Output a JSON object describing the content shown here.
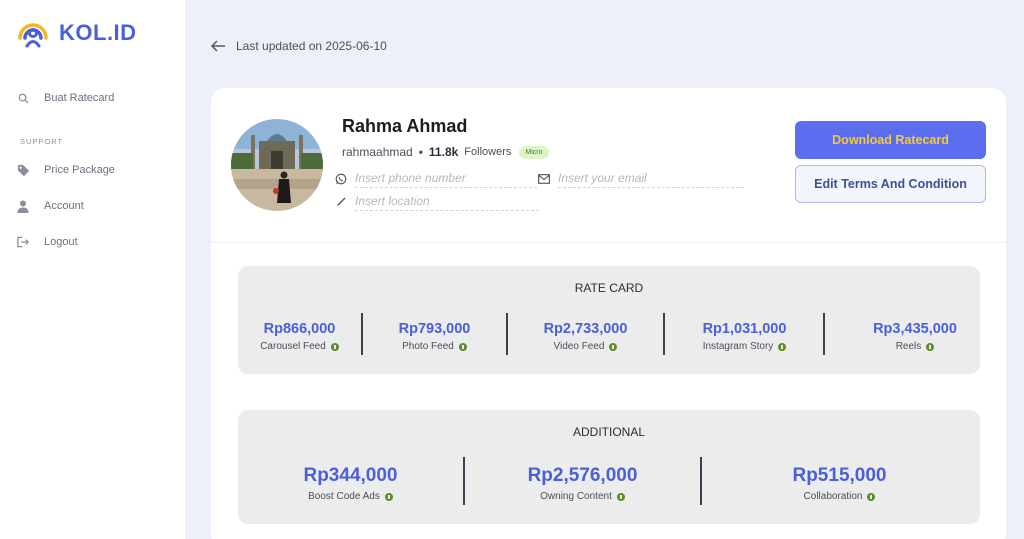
{
  "app": {
    "logo_text": "KOL.ID",
    "accent": "#4a5fd8"
  },
  "sidebar": {
    "items": [
      {
        "label": "Buat Ratecard",
        "icon": "search-icon"
      },
      {
        "label": "Price Package",
        "icon": "tag-icon"
      },
      {
        "label": "Account",
        "icon": "user-icon"
      },
      {
        "label": "Logout",
        "icon": "logout-icon"
      }
    ],
    "section_label": "SUPPORT"
  },
  "header": {
    "last_updated": "Last updated on 2025-06-10"
  },
  "profile": {
    "name": "Rahma Ahmad",
    "username": "rahmaahmad",
    "followers_count": "11.8k",
    "followers_label": "Followers",
    "tier_badge": "Micro",
    "phone_placeholder": "Insert phone number",
    "email_placeholder": "Insert your email",
    "location_placeholder": "Insert location"
  },
  "actions": {
    "download_label": "Download Ratecard",
    "edit_label": "Edit Terms And Condition"
  },
  "rate_card": {
    "title": "RATE CARD",
    "items": [
      {
        "price": "Rp866,000",
        "label": "Carousel Feed"
      },
      {
        "price": "Rp793,000",
        "label": "Photo Feed"
      },
      {
        "price": "Rp2,733,000",
        "label": "Video Feed"
      },
      {
        "price": "Rp1,031,000",
        "label": "Instagram Story"
      },
      {
        "price": "Rp3,435,000",
        "label": "Reels"
      }
    ]
  },
  "additional": {
    "title": "ADDITIONAL",
    "items": [
      {
        "price": "Rp344,000",
        "label": "Boost Code Ads"
      },
      {
        "price": "Rp2,576,000",
        "label": "Owning Content"
      },
      {
        "price": "Rp515,000",
        "label": "Collaboration"
      }
    ]
  }
}
